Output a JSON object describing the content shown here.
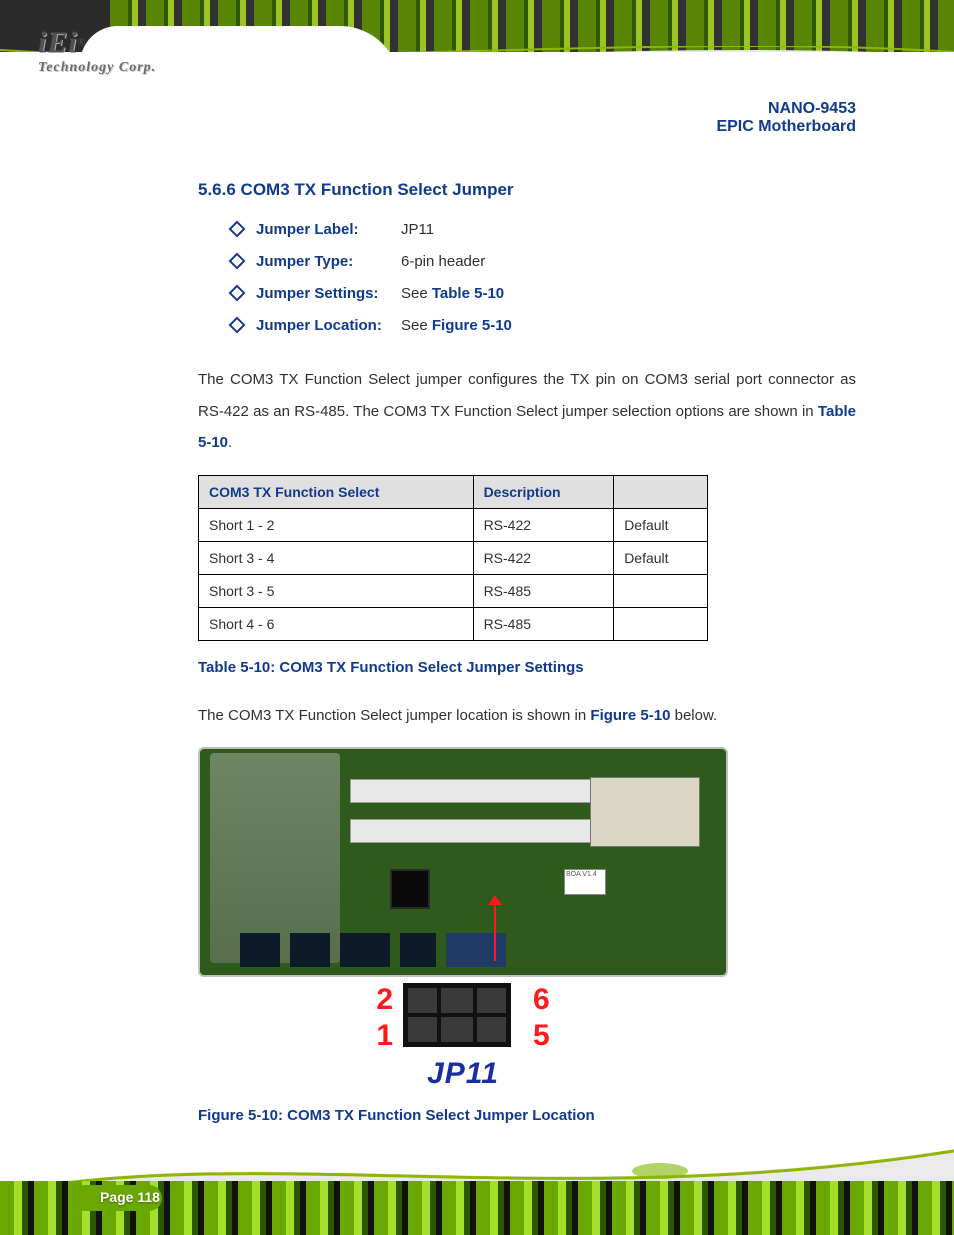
{
  "logo": {
    "brand": "iEi",
    "reg": "®",
    "tagline": "Technology Corp."
  },
  "header": {
    "product": "NANO-9453",
    "subtitle": "EPIC Motherboard"
  },
  "section": {
    "number": "5.6.6",
    "title": "COM3 TX Function Select Jumper"
  },
  "info": {
    "jumperLabelLabel": "Jumper Label:",
    "jumperLabelValue": "JP11",
    "jumperTypeLabel": "Jumper Type:",
    "jumperTypeValue": "6-pin header",
    "jumperSettingsLabel": "Jumper Settings:",
    "jumperSettingsSee": "See",
    "jumperSettingsRef": "Table 5-10",
    "jumperLocationLabel": "Jumper Location:",
    "jumperLocationSee": "See",
    "jumperLocationRef": "Figure 5-10"
  },
  "para1": {
    "textA": "The COM3 TX Function Select jumper configures the TX pin on COM3 serial port connector as RS-422 as an RS-485. The COM3 TX Function Select jumper selection options are shown in ",
    "ref": "Table 5-10",
    "textB": "."
  },
  "table": {
    "headers": [
      "COM3 TX Function Select",
      "Description",
      ""
    ],
    "rows": [
      [
        "Short 1 - 2",
        "RS-422",
        "Default"
      ],
      [
        "Short 3 - 4",
        "RS-422",
        "Default"
      ],
      [
        "Short 3 - 5",
        "RS-485",
        ""
      ],
      [
        "Short 4 - 6",
        "RS-485",
        ""
      ]
    ]
  },
  "tableCaption": "Table 5-10: COM3 TX Function Select Jumper Settings",
  "para2": {
    "textA": "The COM3 TX Function Select jumper location is shown in ",
    "ref": "Figure 5-10",
    "textB": " below."
  },
  "figure": {
    "caption": "Figure 5-10: COM3 TX Function Select Jumper Location",
    "jpLabel": "JP11",
    "pinTopLeft": "2",
    "pinTopRight": "6",
    "pinBottomLeft": "1",
    "pinBottomRight": "5",
    "boardSilk": "BOA V1.4"
  },
  "footer": {
    "page": "Page 118"
  }
}
